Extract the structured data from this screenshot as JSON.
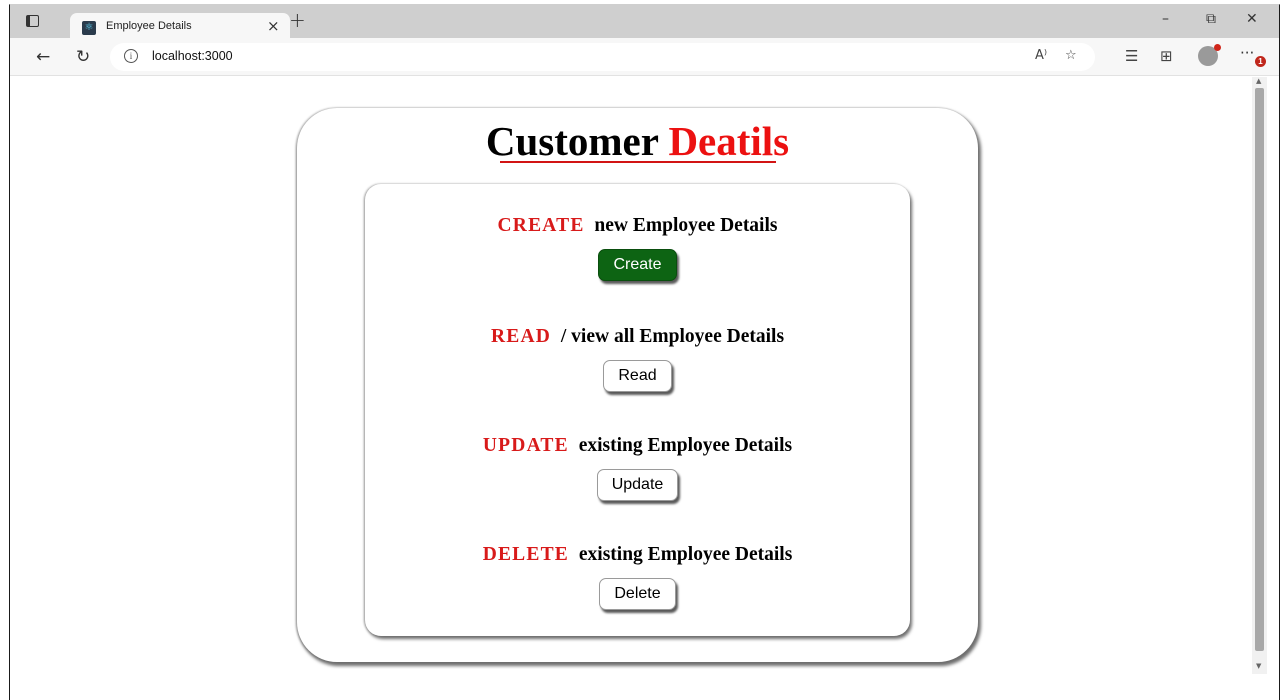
{
  "browser": {
    "tab": {
      "title": "Employee Details",
      "close": "×",
      "favicon": "react-favicon"
    },
    "new_tab": "+",
    "window_controls": {
      "minimize": "–",
      "restore": "⧉",
      "close": "✕"
    },
    "address": {
      "url": "localhost:3000",
      "info_glyph": "i"
    },
    "nav": {
      "back": "←",
      "refresh": "↻"
    },
    "more": "···",
    "notification_count": "1"
  },
  "page": {
    "title_main": "Customer",
    "title_accent": "Deatils",
    "accent_color": "#ec1111",
    "sections": [
      {
        "keyword": "CREATE",
        "text": "new Employee Details",
        "button": "Create",
        "button_color": "#0d6413"
      },
      {
        "keyword": "READ",
        "text": "/ view all Employee Details",
        "button": "Read"
      },
      {
        "keyword": "UPDATE",
        "text": "existing Employee Details",
        "button": "Update"
      },
      {
        "keyword": "DELETE",
        "text": "existing Employee Details",
        "button": "Delete"
      }
    ]
  }
}
